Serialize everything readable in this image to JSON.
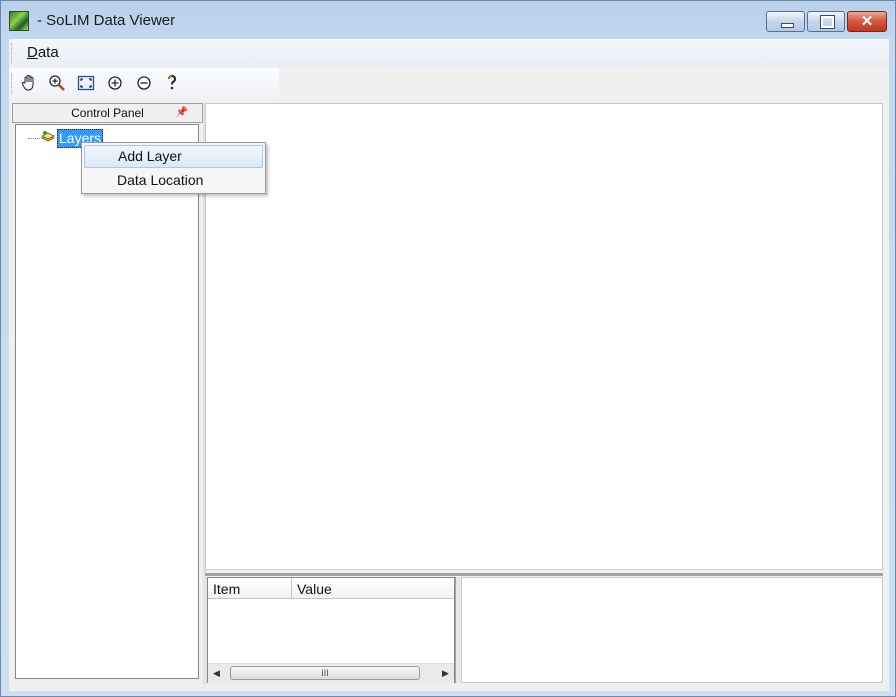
{
  "window": {
    "title": "- SoLIM Data Viewer"
  },
  "menubar": {
    "items": [
      {
        "label": "Data",
        "accel": "D"
      }
    ]
  },
  "toolbar": {
    "tools": [
      "pan-hand",
      "zoom-in-magnifier",
      "full-extent",
      "zoom-in",
      "zoom-out",
      "help"
    ]
  },
  "control_panel": {
    "title": "Control Panel",
    "pin_glyph": "📌",
    "tree": {
      "root_label": "Layers"
    }
  },
  "context_menu": {
    "items": [
      {
        "label": "Add Layer"
      },
      {
        "label": "Data Location"
      }
    ]
  },
  "properties": {
    "columns": [
      "Item",
      "Value"
    ],
    "scroll_thumb_glyph": "III"
  }
}
